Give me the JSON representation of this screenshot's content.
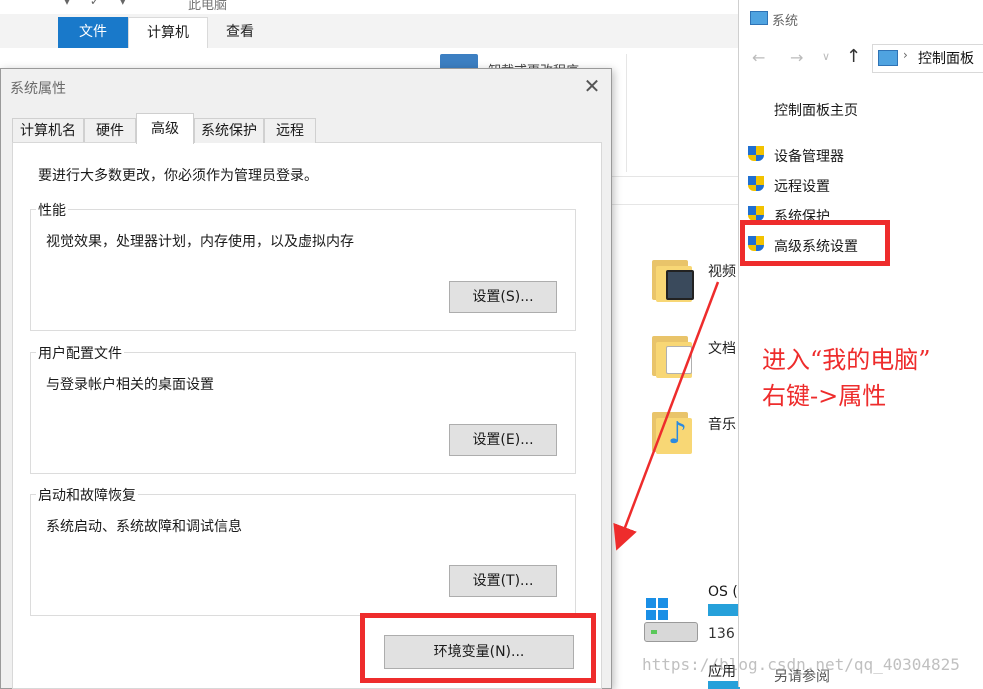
{
  "explorer": {
    "title": "此电脑",
    "ribbon_tabs": [
      "文件",
      "计算机",
      "查看"
    ],
    "uninstall_label": "卸载或更改程序",
    "folders": [
      "视频",
      "文档",
      "音乐"
    ],
    "drive": {
      "label": "OS (",
      "size_text": "136"
    },
    "apps_label": "应用"
  },
  "system_panel": {
    "window_title": "系统",
    "address": "控制面板",
    "home_link": "控制面板主页",
    "links": [
      "设备管理器",
      "远程设置",
      "系统保护",
      "高级系统设置"
    ],
    "see_also": "另请参阅"
  },
  "dialog": {
    "title": "系统属性",
    "close_glyph": "✕",
    "tabs": [
      "计算机名",
      "硬件",
      "高级",
      "系统保护",
      "远程"
    ],
    "active_tab": "高级",
    "admin_note": "要进行大多数更改，你必须作为管理员登录。",
    "groups": [
      {
        "title": "性能",
        "desc": "视觉效果，处理器计划，内存使用，以及虚拟内存",
        "button": "设置(S)..."
      },
      {
        "title": "用户配置文件",
        "desc": "与登录帐户相关的桌面设置",
        "button": "设置(E)..."
      },
      {
        "title": "启动和故障恢复",
        "desc": "系统启动、系统故障和调试信息",
        "button": "设置(T)..."
      }
    ],
    "env_button": "环境变量(N)..."
  },
  "annotation": {
    "line1": "进入“我的电脑”",
    "line2": "右键->属性",
    "color": "#ee2c2c"
  },
  "watermark": "https://blog.csdn.net/qq_40304825"
}
